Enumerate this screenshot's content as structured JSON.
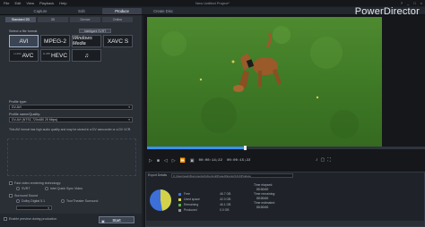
{
  "window": {
    "title": "New Untitled Project*",
    "menu": [
      "File",
      "Edit",
      "View",
      "Playback",
      "Help"
    ],
    "controls": [
      "?",
      "_",
      "□",
      "×"
    ],
    "brand": "PowerDirector"
  },
  "maintabs": [
    {
      "label": "Capture",
      "active": false
    },
    {
      "label": "Edit",
      "active": false
    },
    {
      "label": "Produce",
      "active": true
    },
    {
      "label": "Create Disc",
      "active": false
    }
  ],
  "subtabs": [
    {
      "label": "Standard 2D",
      "active": true
    },
    {
      "label": "3D",
      "active": false
    },
    {
      "label": "Device",
      "active": false
    },
    {
      "label": "Online",
      "active": false
    }
  ],
  "format": {
    "label": "Select a file format",
    "intel_button": "Intelligent SVRT",
    "options": [
      {
        "label": "AVI",
        "prefix": "",
        "selected": true
      },
      {
        "label": "MPEG-2",
        "prefix": "",
        "selected": false
      },
      {
        "label": "Windows Media",
        "prefix": "",
        "selected": false
      },
      {
        "label": "XAVC S",
        "prefix": "",
        "selected": false
      },
      {
        "label": "AVC",
        "prefix": "H.264",
        "selected": false
      },
      {
        "label": "HEVC",
        "prefix": "H.265",
        "selected": false
      },
      {
        "label": "♫",
        "prefix": "",
        "selected": false
      }
    ]
  },
  "profile_type": {
    "label": "Profile type:",
    "value": "DV-AVI"
  },
  "profile_quality": {
    "label": "Profile name/Quality:",
    "value": "DV-AVI (NTSC 720x480 25 Mbps)"
  },
  "description": "This AVI format has high audio quality and may be stored in a DV camcorder or a DV VCR.",
  "options": {
    "fast_render": "Fast video rendering technology:",
    "svrt": "SVRT",
    "intel": "Intel Quick Sync Video",
    "surround": "Surround Sound",
    "dolby": "Dolby Digital 5.1",
    "truetheater": "TrueTheater Surround",
    "surround_select": "",
    "upload": "Upload a copy to CyberLink Cloud",
    "enable_preview": "Enable preview during production"
  },
  "start_button": "Start",
  "player": {
    "timecode": "00:00:14;22",
    "timecode2": "00:00:15;22",
    "progress_fraction": 0.35
  },
  "export_status": {
    "title": "Export Details",
    "path": "C:\\Users\\web\\Documents\\CyberLink\\PowerDirector\\16.0\\Produce",
    "legend": [
      {
        "label": "Free",
        "value": "46.7 GB",
        "color": "#3d6fd8"
      },
      {
        "label": "Used space",
        "value": "42.0 GB",
        "color": "#d3d14a"
      },
      {
        "label": "Remaining",
        "value": "46.1 GB",
        "color": "#5fae4c"
      },
      {
        "label": "Produced",
        "value": "0.0 GB",
        "color": "#8b8f96"
      }
    ],
    "pie": {
      "free": 46.7,
      "used": 42.0
    },
    "time_elapsed_label": "Time elapsed:",
    "time_elapsed": "00:00:00",
    "time_remaining_label": "Time remaining:",
    "time_remaining": "00:00:00",
    "time_estimated_label": "Time estimated:",
    "time_estimated": "00:00:00"
  }
}
